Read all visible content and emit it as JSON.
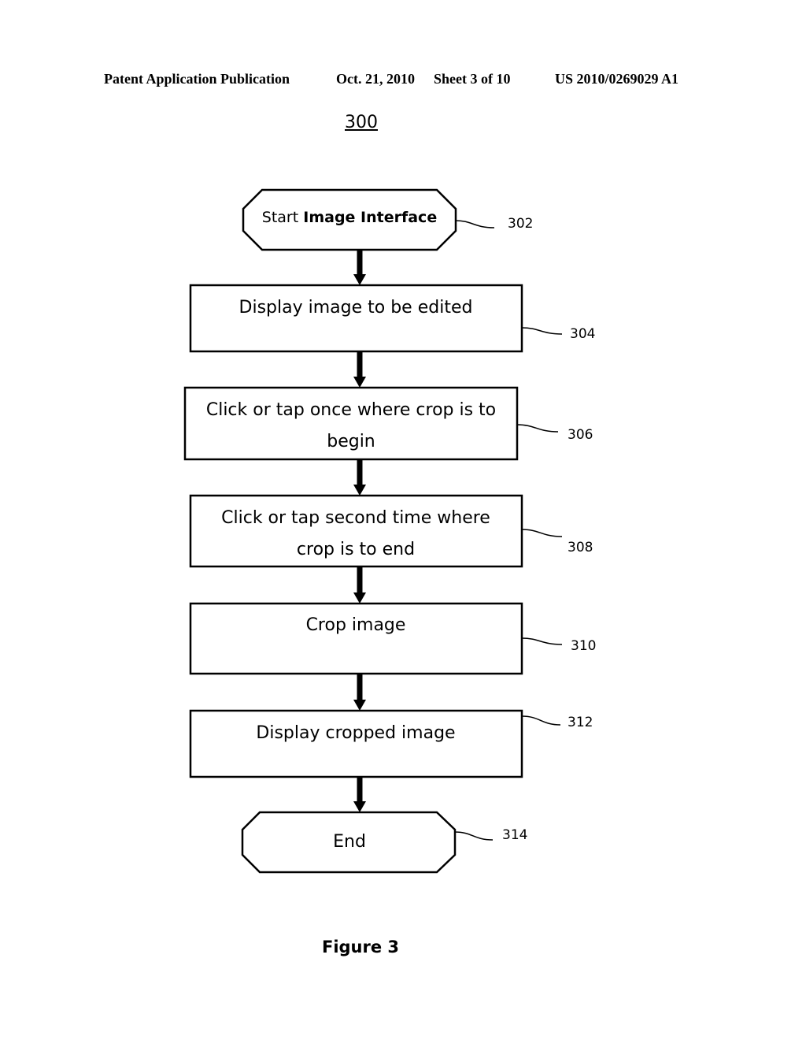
{
  "header": {
    "publication": "Patent Application Publication",
    "date": "Oct. 21, 2010",
    "sheet": "Sheet 3 of 10",
    "patent_number": "US 2010/0269029 A1"
  },
  "figure_number": "300",
  "caption": "Figure 3",
  "nodes": [
    {
      "id": "302",
      "shape": "terminal",
      "text_plain": "Start ",
      "text_bold": "Image Interface",
      "ref": "302"
    },
    {
      "id": "304",
      "shape": "process",
      "lines": [
        "Display image to be edited"
      ],
      "ref": "304"
    },
    {
      "id": "306",
      "shape": "process",
      "lines": [
        "Click or tap once where crop is to",
        "begin"
      ],
      "ref": "306"
    },
    {
      "id": "308",
      "shape": "process",
      "lines": [
        "Click or tap second time where",
        "crop is to end"
      ],
      "ref": "308"
    },
    {
      "id": "310",
      "shape": "process",
      "lines": [
        "Crop image"
      ],
      "ref": "310"
    },
    {
      "id": "312",
      "shape": "process",
      "lines": [
        "Display cropped image"
      ],
      "ref": "312"
    },
    {
      "id": "314",
      "shape": "terminal",
      "lines": [
        "End"
      ],
      "ref": "314"
    }
  ],
  "edges": [
    {
      "from": "302",
      "to": "304"
    },
    {
      "from": "304",
      "to": "306"
    },
    {
      "from": "306",
      "to": "308"
    },
    {
      "from": "308",
      "to": "310"
    },
    {
      "from": "310",
      "to": "312"
    },
    {
      "from": "312",
      "to": "314"
    }
  ]
}
